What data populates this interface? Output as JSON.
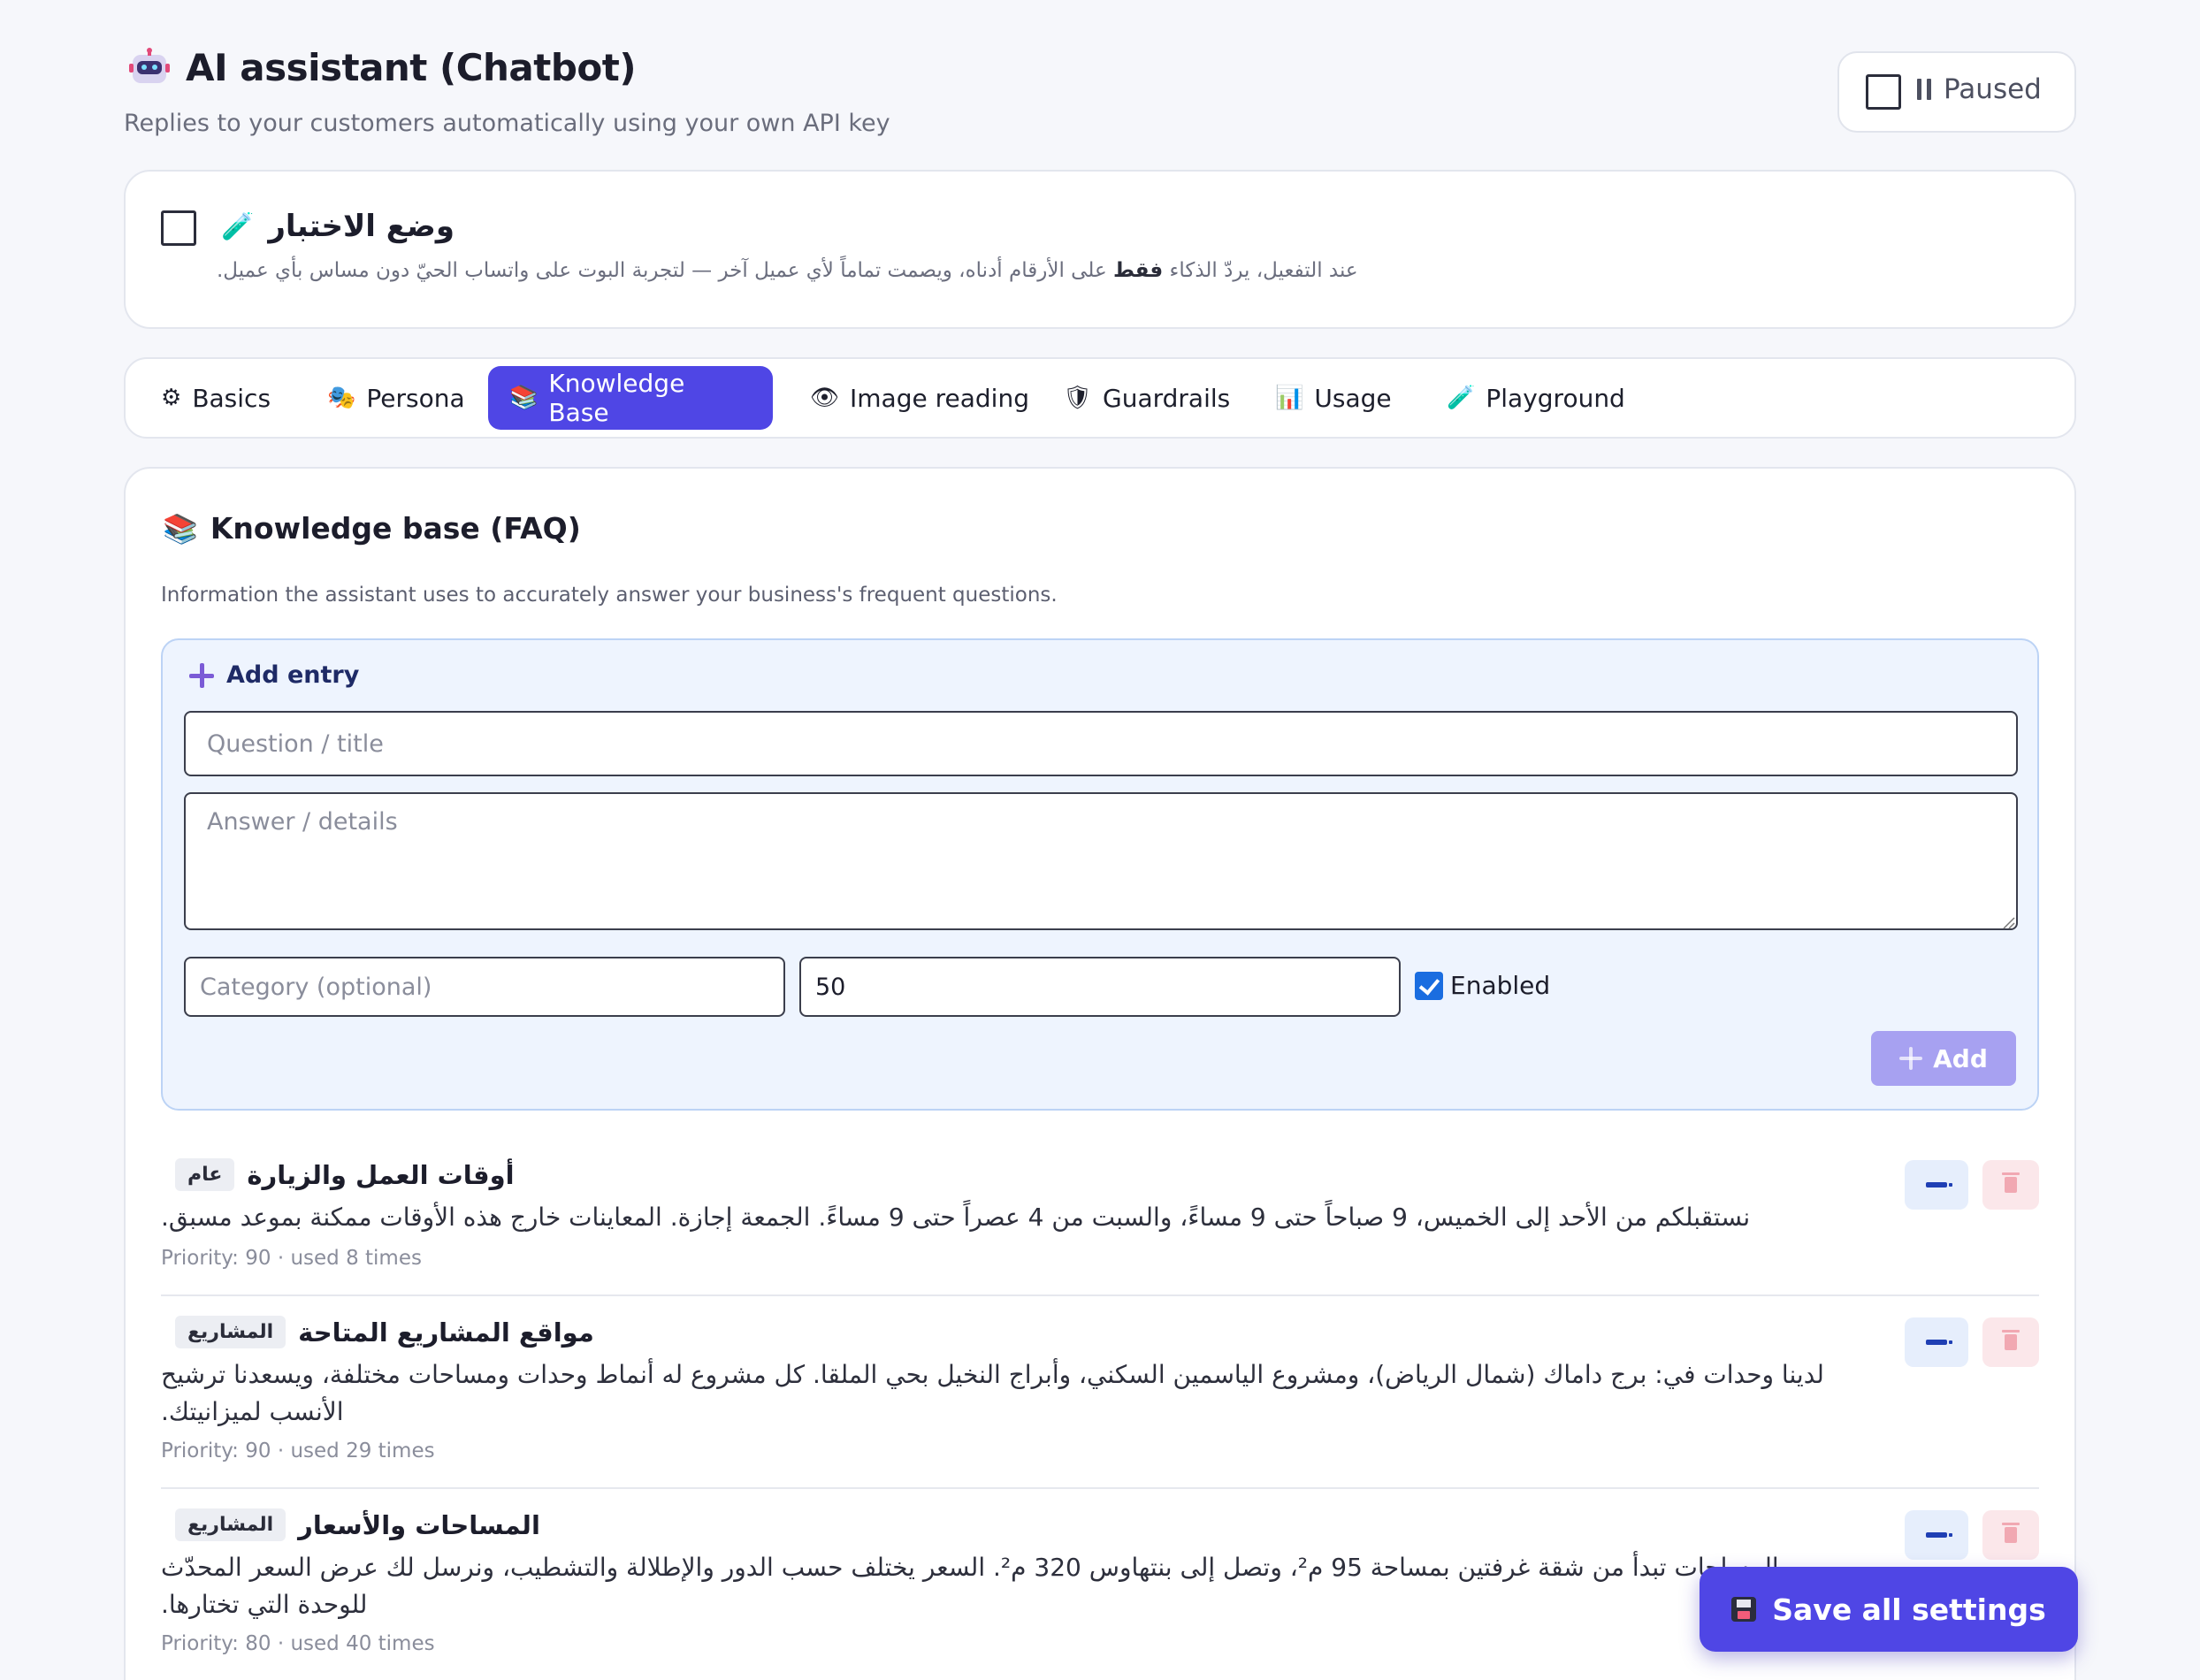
{
  "header": {
    "icon": "robot-icon",
    "title": "AI assistant (Chatbot)",
    "subtitle": "Replies to your customers automatically using your own API key",
    "status_label": "Paused",
    "status_icon": "pause-icon"
  },
  "test_mode": {
    "title": "وضع الاختبار",
    "icon": "test-tube-icon",
    "desc_before": "عند التفعيل، يردّ الذكاء ",
    "desc_bold": "فقط",
    "desc_after": " على الأرقام أدناه، ويصمت تماماً لأي عميل آخر — لتجربة البوت على واتساب الحيّ دون مساس بأي عميل."
  },
  "tabs": [
    {
      "label": "Basics",
      "icon": "gear-icon",
      "glyph": "⚙"
    },
    {
      "label": "Persona",
      "icon": "masks-icon",
      "glyph": "🎭"
    },
    {
      "label": "Knowledge Base",
      "icon": "books-icon",
      "glyph": "📚"
    },
    {
      "label": "Image reading",
      "icon": "eye-icon",
      "glyph": "👁"
    },
    {
      "label": "Guardrails",
      "icon": "shield-icon",
      "glyph": "🛡"
    },
    {
      "label": "Usage",
      "icon": "bar-chart-icon",
      "glyph": "📊"
    },
    {
      "label": "Playground",
      "icon": "test-tube-icon",
      "glyph": "🧪"
    }
  ],
  "active_tab": "Knowledge Base",
  "knowledge": {
    "title": "Knowledge base (FAQ)",
    "icon": "books-icon",
    "description": "Information the assistant uses to accurately answer your business's frequent questions.",
    "add_entry_label": "Add entry",
    "question_placeholder": "Question / title",
    "answer_placeholder": "Answer / details",
    "category_placeholder": "Category (optional)",
    "priority_value": "50",
    "enabled_label": "Enabled",
    "enabled_checked": true,
    "add_button_label": "Add"
  },
  "entries": [
    {
      "title": "أوقات العمل والزيارة",
      "category": "عام",
      "answer": "نستقبلكم من الأحد إلى الخميس، 9 صباحاً حتى 9 مساءً، والسبت من 4 عصراً حتى 9 مساءً. الجمعة إجازة. المعاينات خارج هذه الأوقات ممكنة بموعد مسبق.",
      "meta": "Priority: 90 · used 8 times"
    },
    {
      "title": "مواقع المشاريع المتاحة",
      "category": "المشاريع",
      "answer": "لدينا وحدات في: برج داماك (شمال الرياض)، ومشروع الياسمين السكني، وأبراج النخيل بحي الملقا. كل مشروع له أنماط وحدات ومساحات مختلفة، ويسعدنا ترشيح الأنسب لميزانيتك.",
      "meta": "Priority: 90 · used 29 times"
    },
    {
      "title": "المساحات والأسعار",
      "category": "المشاريع",
      "answer": "المساحات تبدأ من شقة غرفتين بمساحة 95 م²، وتصل إلى بنتهاوس 320 م². السعر يختلف حسب الدور والإطلالة والتشطيب، ونرسل لك عرض السعر المحدّث للوحدة التي تختارها.",
      "meta": "Priority: 80 · used 40 times"
    }
  ],
  "save_button_label": "Save all settings",
  "colors": {
    "accent": "#4f46e5",
    "add_disabled": "#a7a1f1",
    "panel_bg": "#eef4fe",
    "checkbox_checked": "#1a6de0"
  }
}
